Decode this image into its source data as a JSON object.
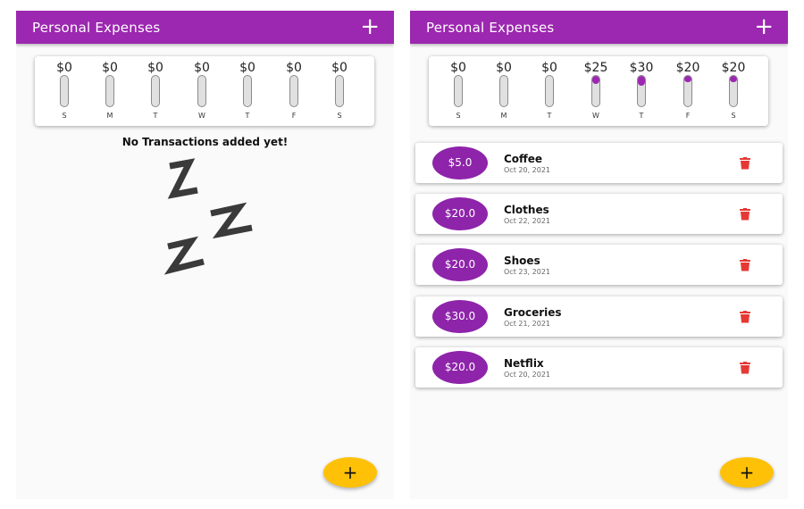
{
  "colors": {
    "primary": "#9c27b0",
    "accent": "#ffc107",
    "danger": "#e53935"
  },
  "screens": [
    {
      "app_title": "Personal Expenses",
      "add_icon": "+",
      "chart": [
        {
          "day": "S",
          "amount_label": "$0",
          "fraction": 0
        },
        {
          "day": "M",
          "amount_label": "$0",
          "fraction": 0
        },
        {
          "day": "T",
          "amount_label": "$0",
          "fraction": 0
        },
        {
          "day": "W",
          "amount_label": "$0",
          "fraction": 0
        },
        {
          "day": "T",
          "amount_label": "$0",
          "fraction": 0
        },
        {
          "day": "F",
          "amount_label": "$0",
          "fraction": 0
        },
        {
          "day": "S",
          "amount_label": "$0",
          "fraction": 0
        }
      ],
      "empty_message": "No Transactions added yet!",
      "empty_icon": "zzz-sleep-icon",
      "fab_label": "+"
    },
    {
      "app_title": "Personal Expenses",
      "add_icon": "+",
      "chart": [
        {
          "day": "S",
          "amount_label": "$0",
          "fraction": 0
        },
        {
          "day": "M",
          "amount_label": "$0",
          "fraction": 0
        },
        {
          "day": "T",
          "amount_label": "$0",
          "fraction": 0
        },
        {
          "day": "W",
          "amount_label": "$25",
          "fraction": 0.26
        },
        {
          "day": "T",
          "amount_label": "$30",
          "fraction": 0.32
        },
        {
          "day": "F",
          "amount_label": "$20",
          "fraction": 0.21
        },
        {
          "day": "S",
          "amount_label": "$20",
          "fraction": 0.21
        }
      ],
      "transactions": [
        {
          "amount": "$5.0",
          "title": "Coffee",
          "date": "Oct 20, 2021"
        },
        {
          "amount": "$20.0",
          "title": "Clothes",
          "date": "Oct 22, 2021"
        },
        {
          "amount": "$20.0",
          "title": "Shoes",
          "date": "Oct 23, 2021"
        },
        {
          "amount": "$30.0",
          "title": "Groceries",
          "date": "Oct 21, 2021"
        },
        {
          "amount": "$20.0",
          "title": "Netflix",
          "date": "Oct 20, 2021"
        }
      ],
      "delete_icon": "trash-icon",
      "fab_label": "+"
    }
  ]
}
